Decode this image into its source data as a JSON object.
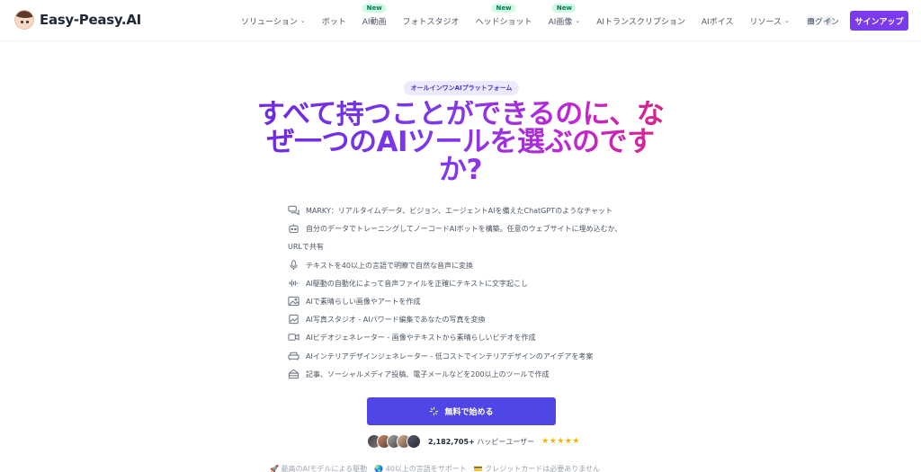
{
  "brand": {
    "name": "Easy-Peasy.AI"
  },
  "nav": {
    "items": [
      {
        "label": "ソリューション",
        "dropdown": true,
        "new": false
      },
      {
        "label": "ボット",
        "dropdown": false,
        "new": false
      },
      {
        "label": "AI動画",
        "dropdown": false,
        "new": true
      },
      {
        "label": "フォトスタジオ",
        "dropdown": false,
        "new": false
      },
      {
        "label": "ヘッドショット",
        "dropdown": false,
        "new": true
      },
      {
        "label": "AI画像",
        "dropdown": true,
        "new": true
      },
      {
        "label": "AIトランスクリプション",
        "dropdown": false,
        "new": false
      },
      {
        "label": "AIボイス",
        "dropdown": false,
        "new": false
      },
      {
        "label": "リソース",
        "dropdown": true,
        "new": false
      }
    ],
    "new_label": "New",
    "login": "ログイン",
    "signup": "サインアップ"
  },
  "hero": {
    "badge": "オールインワンAIプラットフォーム",
    "headline_line1": "すべて持つことができるのに、な",
    "headline_line2": "ぜ一つのAIツールを選ぶのです",
    "headline_line3": "か?",
    "features": [
      {
        "icon": "chat-bubbles-icon",
        "text": "MARKY：リアルタイムデータ、ビジョン、エージェントAIを備えたChatGPTのようなチャット"
      },
      {
        "icon": "bot-icon",
        "text": "自分のデータでトレーニングしてノーコードAIボットを構築。任意のウェブサイトに埋め込むか、"
      },
      {
        "icon": "",
        "text": "URLで共有"
      },
      {
        "icon": "microphone-icon",
        "text": "テキストを40以上の言語で明瞭で自然な音声に変換"
      },
      {
        "icon": "waveform-icon",
        "text": "AI駆動の自動化によって音声ファイルを正確にテキストに文字起こし"
      },
      {
        "icon": "images-icon",
        "text": "AIで素晴らしい画像やアートを作成"
      },
      {
        "icon": "photo-icon",
        "text": "AI写真スタジオ - AIパワード編集であなたの写真を変換"
      },
      {
        "icon": "video-icon",
        "text": "AIビデオジェネレーター - 画像やテキストから素晴らしいビデオを作成"
      },
      {
        "icon": "sofa-icon",
        "text": "AIインテリアデザインジェネレーター - 低コストでインテリアデザインのアイデアを考案"
      },
      {
        "icon": "stack-icon",
        "text": "記事、ソーシャルメディア投稿、電子メールなどを200以上のツールで作成"
      }
    ],
    "cta": "無料で始める",
    "users_count": "2,182,705+",
    "users_label": "ハッピーユーザー",
    "stars": "★★★★★",
    "bottom_text": "🚀 最高のAIモデルによる駆動　🌏 40以上の言語をサポート　💳 クレジットカードは必要ありません"
  },
  "colors": {
    "accent": "#7c3aed",
    "cta": "#4f46e5",
    "new_badge_bg": "#d1fae5",
    "headline_gradient": [
      "#6d28d9",
      "#7c3aed",
      "#c026d3",
      "#db2777"
    ]
  }
}
